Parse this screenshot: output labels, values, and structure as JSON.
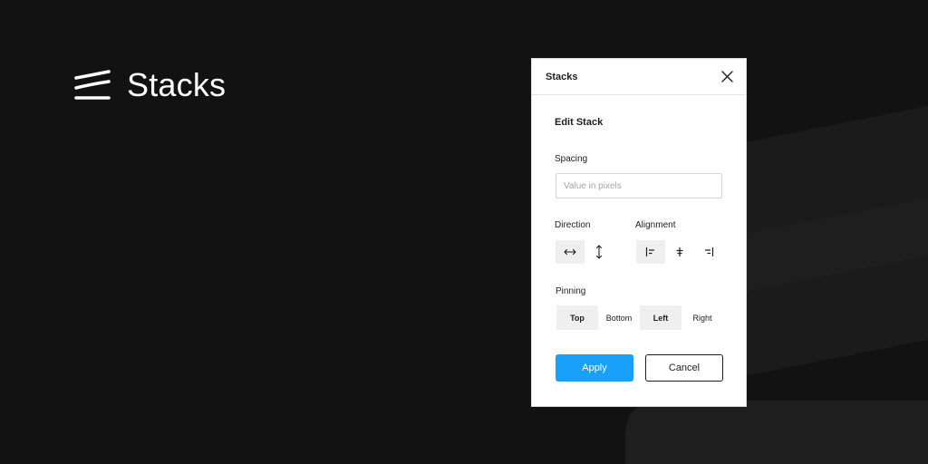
{
  "brand": {
    "name": "Stacks",
    "icon": "stack-lines-icon"
  },
  "dialog": {
    "title": "Stacks",
    "close_icon": "close-icon",
    "section_title": "Edit Stack",
    "spacing": {
      "label": "Spacing",
      "value": "",
      "placeholder": "Value in pixels"
    },
    "direction": {
      "label": "Direction",
      "options": [
        {
          "icon": "horizontal-arrows-icon",
          "active": true
        },
        {
          "icon": "vertical-arrows-icon",
          "active": false
        }
      ]
    },
    "alignment": {
      "label": "Alignment",
      "options": [
        {
          "icon": "align-start-icon",
          "active": true
        },
        {
          "icon": "align-center-icon",
          "active": false
        },
        {
          "icon": "align-end-icon",
          "active": false
        }
      ]
    },
    "pinning": {
      "label": "Pinning",
      "options": [
        {
          "label": "Top",
          "active": true
        },
        {
          "label": "Bottom",
          "active": false
        },
        {
          "label": "Left",
          "active": true
        },
        {
          "label": "Right",
          "active": false
        }
      ]
    },
    "apply_label": "Apply",
    "cancel_label": "Cancel"
  },
  "colors": {
    "background": "#121212",
    "accent": "#18a0fb",
    "panel": "#ffffff",
    "active_toggle": "#efefef"
  }
}
